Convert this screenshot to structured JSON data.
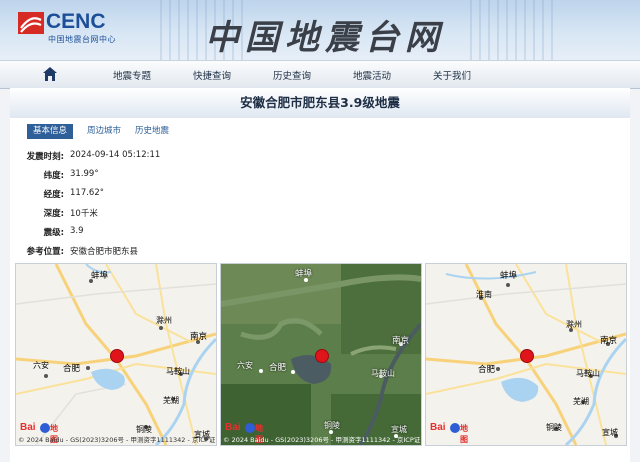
{
  "site": {
    "logo_text": "CENC",
    "logo_subtitle": "中国地震台网中心",
    "banner_title": "中国地震台网"
  },
  "nav": {
    "home_icon": "home-icon",
    "items": [
      "地震专题",
      "快捷查询",
      "历史查询",
      "地震活动",
      "关于我们"
    ]
  },
  "page": {
    "title": "安徽合肥市肥东县3.9级地震",
    "tabs": [
      {
        "label": "基本信息",
        "active": true
      },
      {
        "label": "周边城市",
        "active": false
      },
      {
        "label": "历史地震",
        "active": false
      }
    ]
  },
  "info": [
    {
      "label": "发震时刻:",
      "value": "2024-09-14 05:12:11"
    },
    {
      "label": "纬度:",
      "value": "31.99°"
    },
    {
      "label": "经度:",
      "value": "117.62°"
    },
    {
      "label": "深度:",
      "value": "10千米"
    },
    {
      "label": "震级:",
      "value": "3.9"
    },
    {
      "label": "参考位置:",
      "value": "安徽合肥市肥东县"
    }
  ],
  "maps": [
    {
      "kind": "road",
      "cities": [
        "蚌埠",
        "滁州",
        "南京",
        "六安",
        "合肥",
        "马鞍山",
        "芜湖",
        "铜陵",
        "宣城"
      ],
      "baidu_logo": "Bai",
      "baidu_map": "地图",
      "copyright": "© 2024 Baidu - GS(2023)3206号 - 甲测资字1111342 - 京ICP证"
    },
    {
      "kind": "satellite",
      "cities": [
        "蚌埠",
        "南京",
        "六安",
        "合肥",
        "马鞍山",
        "铜陵",
        "宣城"
      ],
      "baidu_logo": "Bai",
      "baidu_map": "地图",
      "copyright": "© 2024 Baidu - GS(2023)3206号 - 甲测资字1111342 - 京ICP证"
    },
    {
      "kind": "road",
      "cities": [
        "淮南",
        "蚌埠",
        "滁州",
        "南京",
        "合肥",
        "马鞍山",
        "芜湖",
        "铜陵",
        "宣城"
      ],
      "baidu_logo": "Bai",
      "baidu_map": "地图",
      "copyright": "© 2024 Baidu - GS(2023)3206号 - 甲测资字1111342 - 京ICP证"
    }
  ],
  "colors": {
    "accent": "#2f5f98",
    "epicenter": "#e0141b",
    "brand": "#1d4f99"
  }
}
